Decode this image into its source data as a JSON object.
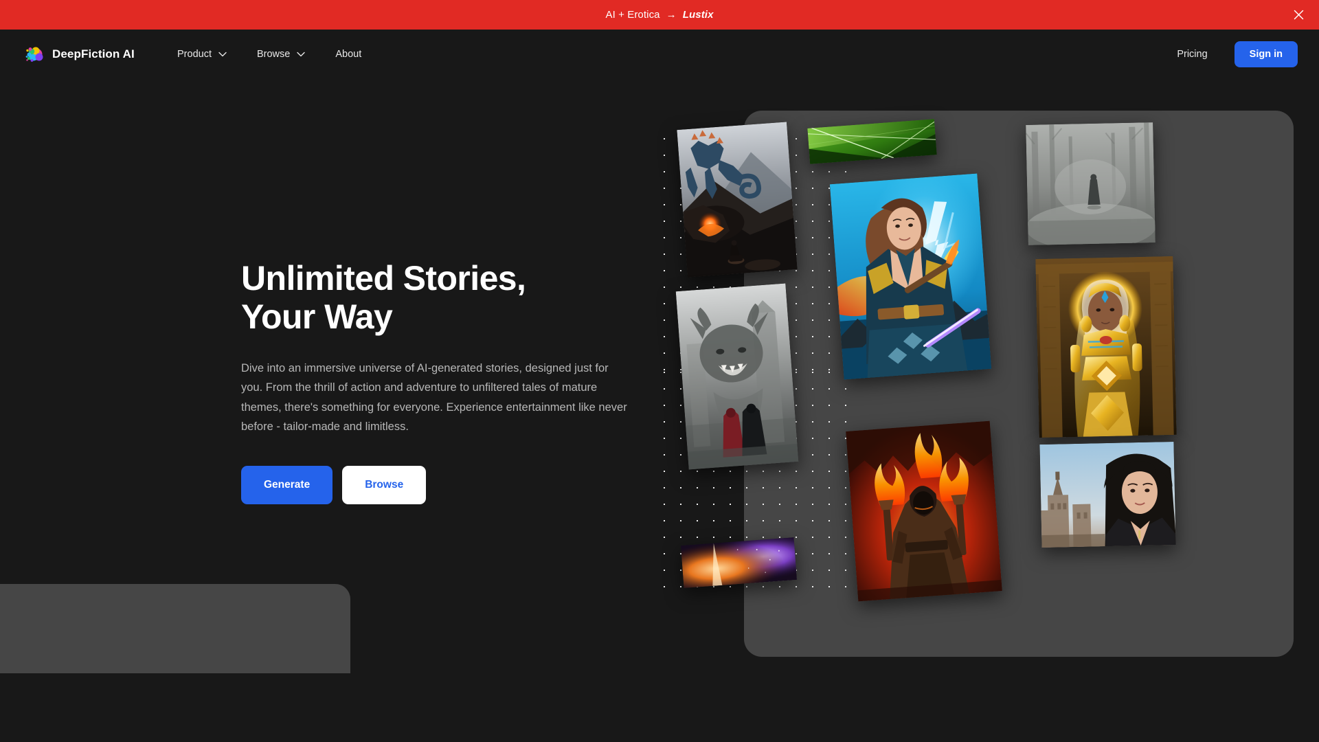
{
  "banner": {
    "prefix": "AI + Erotica",
    "arrow": "→",
    "brand": "Lustix",
    "close_icon": "close-icon",
    "background": "#e12a24"
  },
  "header": {
    "logo": {
      "text": "DeepFiction AI",
      "icon": "colorful-dots-logo"
    },
    "nav": [
      {
        "label": "Product",
        "has_dropdown": true,
        "icon": "chevron-down-icon"
      },
      {
        "label": "Browse",
        "has_dropdown": true,
        "icon": "chevron-down-icon"
      },
      {
        "label": "About",
        "has_dropdown": false
      }
    ],
    "pricing_label": "Pricing",
    "signin_label": "Sign in",
    "accent": "#2563eb"
  },
  "hero": {
    "title": "Unlimited Stories, Your Way",
    "body": "Dive into an immersive universe of AI-generated stories, designed just for you. From the thrill of action and adventure to unfiltered tales of mature themes, there's something for everyone. Experience entertainment like never before - tailor-made and limitless.",
    "primary_cta": "Generate",
    "secondary_cta": "Browse"
  },
  "collage": {
    "cards": [
      {
        "name": "dragon-on-cliff",
        "alt": "Blue dragon standing on a rocky cliff with lava and a rider below"
      },
      {
        "name": "green-abstract",
        "alt": "Green abstract banner with diagonal light streaks"
      },
      {
        "name": "horned-beast",
        "alt": "Horned beast looming in fog over two cloaked figures"
      },
      {
        "name": "purple-nebula",
        "alt": "Purple and orange nebula light burst"
      },
      {
        "name": "lightning-mage",
        "alt": "Female mage with fire wand and blue lightning"
      },
      {
        "name": "torch-warrior",
        "alt": "Hooded warrior holding two flaming torches"
      },
      {
        "name": "foggy-forest",
        "alt": "Lone figure walking in a foggy forest"
      },
      {
        "name": "golden-queen",
        "alt": "Golden-armored queen with halo in a temple"
      },
      {
        "name": "city-portrait",
        "alt": "Dark-haired woman portrait with city skyline"
      }
    ]
  }
}
